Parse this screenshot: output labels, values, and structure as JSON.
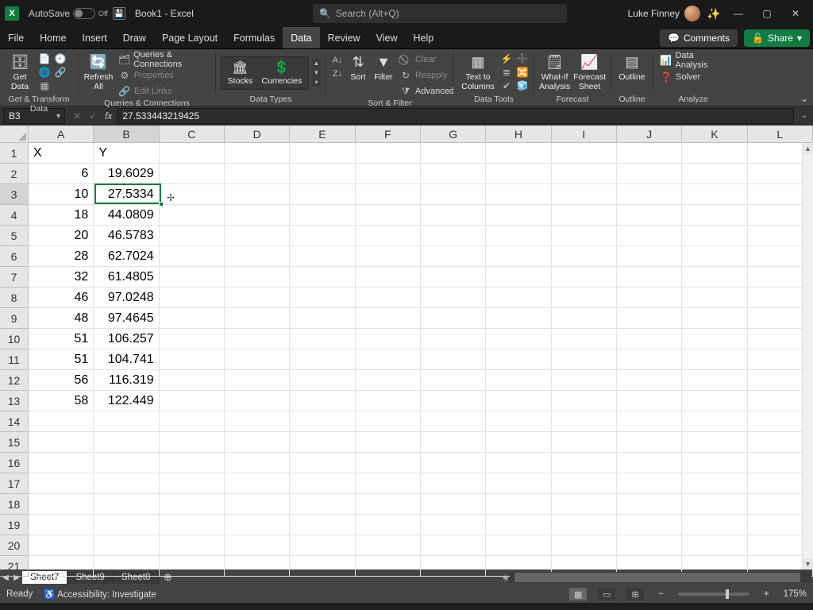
{
  "titlebar": {
    "autosave_label": "AutoSave",
    "autosave_state": "Off",
    "doc_title": "Book1 - Excel",
    "search_placeholder": "Search (Alt+Q)",
    "user_name": "Luke Finney"
  },
  "menu": {
    "tabs": [
      "File",
      "Home",
      "Insert",
      "Draw",
      "Page Layout",
      "Formulas",
      "Data",
      "Review",
      "View",
      "Help"
    ],
    "active": "Data",
    "comments": "Comments",
    "share": "Share"
  },
  "ribbon": {
    "groups": {
      "get_transform": {
        "label": "Get & Transform Data",
        "get_data": "Get\nData"
      },
      "queries": {
        "label": "Queries & Connections",
        "refresh": "Refresh\nAll",
        "qc": "Queries & Connections",
        "props": "Properties",
        "links": "Edit Links"
      },
      "types": {
        "label": "Data Types",
        "stocks": "Stocks",
        "currencies": "Currencies"
      },
      "sortfilter": {
        "label": "Sort & Filter",
        "sort": "Sort",
        "filter": "Filter",
        "clear": "Clear",
        "reapply": "Reapply",
        "advanced": "Advanced"
      },
      "datatools": {
        "label": "Data Tools",
        "t2c": "Text to\nColumns"
      },
      "forecast": {
        "label": "Forecast",
        "whatif": "What-If\nAnalysis",
        "sheet": "Forecast\nSheet"
      },
      "outline": {
        "label": "Outline",
        "btn": "Outline"
      },
      "analyze": {
        "label": "Analyze",
        "da": "Data Analysis",
        "solver": "Solver"
      }
    }
  },
  "formula_bar": {
    "name_box": "B3",
    "formula": "27.533443219425"
  },
  "grid": {
    "col_width_std": 84,
    "col_width_ab": 84,
    "columns": [
      "A",
      "B",
      "C",
      "D",
      "E",
      "F",
      "G",
      "H",
      "I",
      "J",
      "K",
      "L"
    ],
    "sel_col": "B",
    "sel_row": 3,
    "visible_rows": 21,
    "data": {
      "headers": {
        "A": "X",
        "B": "Y"
      },
      "rows": [
        {
          "A": "6",
          "B": "19.6029"
        },
        {
          "A": "10",
          "B": "27.5334"
        },
        {
          "A": "18",
          "B": "44.0809"
        },
        {
          "A": "20",
          "B": "46.5783"
        },
        {
          "A": "28",
          "B": "62.7024"
        },
        {
          "A": "32",
          "B": "61.4805"
        },
        {
          "A": "46",
          "B": "97.0248"
        },
        {
          "A": "48",
          "B": "97.4645"
        },
        {
          "A": "51",
          "B": "106.257"
        },
        {
          "A": "51",
          "B": "104.741"
        },
        {
          "A": "56",
          "B": "116.319"
        },
        {
          "A": "58",
          "B": "122.449"
        }
      ]
    }
  },
  "sheets": {
    "tabs": [
      "Sheet7",
      "Sheet9",
      "Sheet8"
    ],
    "active": "Sheet7"
  },
  "status": {
    "ready": "Ready",
    "access": "Accessibility: Investigate",
    "zoom": "175%"
  }
}
